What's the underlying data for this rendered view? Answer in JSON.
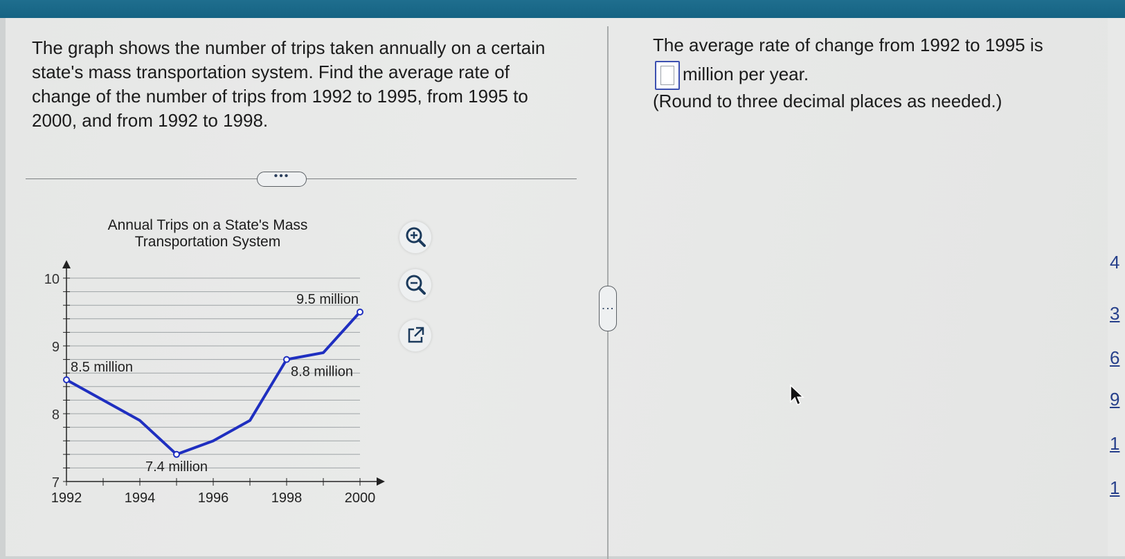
{
  "question": {
    "text": "The graph shows the number of trips taken annually on a certain state's mass transportation system. Find the average rate of change of the number of trips from 1992 to 1995, from 1995 to 2000, and from 1992 to 1998."
  },
  "separator": {
    "more_label": "•••"
  },
  "divider": {
    "handle_label": "⋮"
  },
  "chart_data": {
    "type": "line",
    "title": "Annual Trips on a State's Mass Transportation System",
    "title_lines": [
      "Annual Trips on a State's Mass",
      "Transportation System"
    ],
    "x": [
      1992,
      1993,
      1994,
      1995,
      1996,
      1997,
      1998,
      1999,
      2000
    ],
    "series": [
      {
        "values": [
          8.5,
          8.2,
          7.9,
          7.4,
          7.6,
          7.9,
          8.8,
          8.9,
          9.5
        ]
      }
    ],
    "marked_points": [
      1992,
      1995,
      1998,
      2000
    ],
    "annotations": [
      {
        "x": 1992,
        "text": "8.5 million"
      },
      {
        "x": 1995,
        "text": "7.4 million"
      },
      {
        "x": 1998,
        "text": "8.8 million"
      },
      {
        "x": 2000,
        "text": "9.5 million"
      }
    ],
    "xlim": [
      1992,
      2000
    ],
    "ylim": [
      7,
      10
    ],
    "xticks": [
      1992,
      1994,
      1996,
      1998,
      2000
    ],
    "yticks": [
      7,
      8,
      9,
      10
    ],
    "grid": true,
    "line_color": "#1f2fc0"
  },
  "tools": {
    "zoom_in": "zoom-in-icon",
    "zoom_out": "zoom-out-icon",
    "popout": "external-link-icon"
  },
  "answer": {
    "line1": "The average rate of change from 1992 to 1995 is",
    "line2": "million per year.",
    "hint": "(Round to three decimal places as needed.)",
    "value": ""
  },
  "edge_glyphs": [
    "4",
    "3",
    "6",
    "9",
    "1",
    "1"
  ]
}
